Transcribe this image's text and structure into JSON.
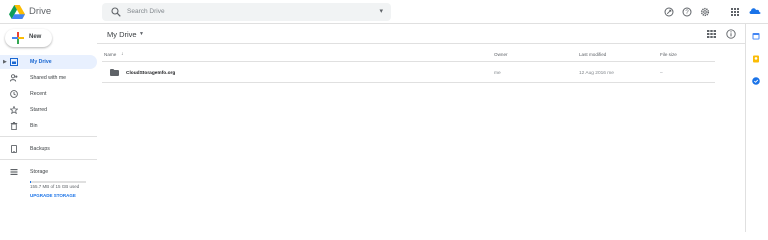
{
  "app": {
    "title": "Drive"
  },
  "search": {
    "placeholder": "Search Drive"
  },
  "new_button": {
    "label": "New"
  },
  "sidebar": {
    "items": [
      {
        "label": "My Drive",
        "icon": "my-drive-icon",
        "active": true
      },
      {
        "label": "Shared with me",
        "icon": "shared-icon"
      },
      {
        "label": "Recent",
        "icon": "clock-icon"
      },
      {
        "label": "Starred",
        "icon": "star-icon"
      },
      {
        "label": "Bin",
        "icon": "trash-icon"
      }
    ],
    "backups": {
      "label": "Backups",
      "icon": "phone-icon"
    },
    "storage": {
      "label": "Storage",
      "used_text": "155.7 MB of 15 GB used",
      "used_fraction": 0.01,
      "upgrade_label": "UPGRADE STORAGE"
    }
  },
  "main": {
    "breadcrumb": "My Drive",
    "columns": [
      "Name",
      "Owner",
      "Last modified",
      "File size"
    ],
    "rows": [
      {
        "name": "CloudStorageInfo.org",
        "owner": "me",
        "modified": "12 Aug 2016 me",
        "size": "–"
      }
    ]
  },
  "colors": {
    "accent": "#1a73e8",
    "active_bg": "#e8f0fe",
    "drive_green": "#0f9d58",
    "drive_yellow": "#f4b400",
    "drive_blue": "#4285f4"
  }
}
